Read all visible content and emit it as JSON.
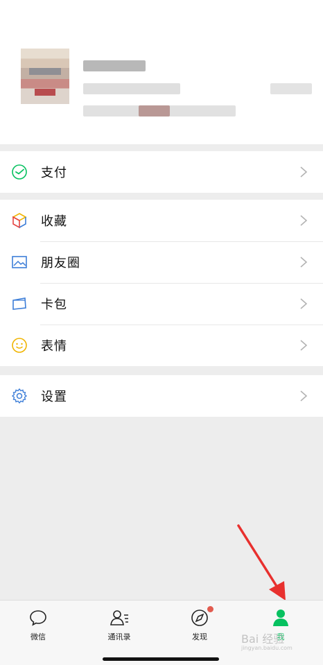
{
  "menu": {
    "pay": "支付",
    "favorites": "收藏",
    "moments": "朋友圈",
    "cards": "卡包",
    "stickers": "表情",
    "settings": "设置"
  },
  "tabbar": {
    "chats": "微信",
    "contacts": "通讯录",
    "discover": "发现",
    "me": "我",
    "active_color": "#07c160",
    "badge_color": "#e25b4f"
  },
  "watermark": {
    "text": "Bai 经验",
    "url": "jingyan.baidu.com"
  },
  "colors": {
    "background": "#ededed",
    "arrow": "#e8302e"
  }
}
